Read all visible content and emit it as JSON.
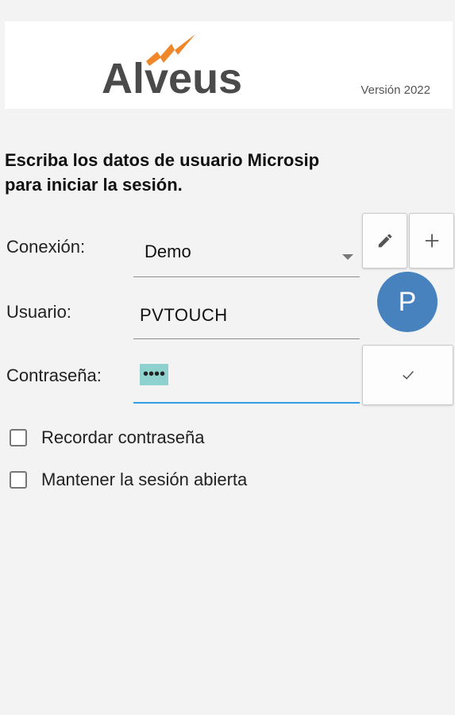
{
  "header": {
    "logo_text": "Alveus",
    "version": "Versión 2022"
  },
  "instructions": {
    "line1": "Escriba los datos de usuario Microsip",
    "line2": "para iniciar la sesión."
  },
  "form": {
    "connection_label": "Conexión:",
    "connection_value": "Demo",
    "user_label": "Usuario:",
    "user_value": "PVTOUCH",
    "password_label": "Contraseña:",
    "password_value": "••••"
  },
  "avatar": {
    "initial": "P"
  },
  "options": {
    "remember_password": "Recordar contraseña",
    "keep_session": "Mantener la sesión abierta"
  },
  "colors": {
    "accent": "#2f9de0",
    "avatar": "#4782bf",
    "logo_orange": "#f0872a",
    "logo_gray": "#4a4a4a"
  }
}
